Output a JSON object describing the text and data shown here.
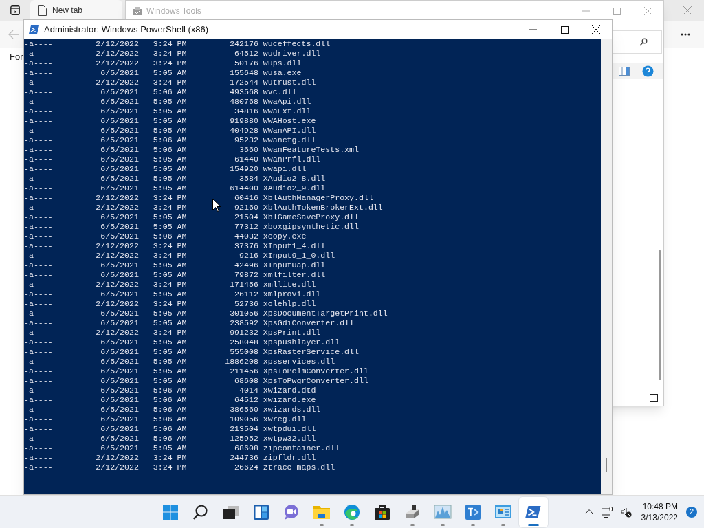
{
  "browser": {
    "tabs": [
      {
        "label": "New tab"
      }
    ],
    "page_text": "For"
  },
  "explorer": {
    "title": "Windows Tools"
  },
  "powershell": {
    "title": "Administrator: Windows PowerShell (x86)",
    "lines": [
      {
        "mode": "-a----",
        "date": "2/12/2022",
        "time": "3:24 PM",
        "size": "242176",
        "name": "wuceffects.dll"
      },
      {
        "mode": "-a----",
        "date": "2/12/2022",
        "time": "3:24 PM",
        "size": "64512",
        "name": "wudriver.dll"
      },
      {
        "mode": "-a----",
        "date": "2/12/2022",
        "time": "3:24 PM",
        "size": "50176",
        "name": "wups.dll"
      },
      {
        "mode": "-a----",
        "date": "6/5/2021",
        "time": "5:05 AM",
        "size": "155648",
        "name": "wusa.exe"
      },
      {
        "mode": "-a----",
        "date": "2/12/2022",
        "time": "3:24 PM",
        "size": "172544",
        "name": "wutrust.dll"
      },
      {
        "mode": "-a----",
        "date": "6/5/2021",
        "time": "5:06 AM",
        "size": "493568",
        "name": "wvc.dll"
      },
      {
        "mode": "-a----",
        "date": "6/5/2021",
        "time": "5:05 AM",
        "size": "480768",
        "name": "WwaApi.dll"
      },
      {
        "mode": "-a----",
        "date": "6/5/2021",
        "time": "5:05 AM",
        "size": "34816",
        "name": "WwaExt.dll"
      },
      {
        "mode": "-a----",
        "date": "6/5/2021",
        "time": "5:05 AM",
        "size": "919880",
        "name": "WWAHost.exe"
      },
      {
        "mode": "-a----",
        "date": "6/5/2021",
        "time": "5:05 AM",
        "size": "404928",
        "name": "WWanAPI.dll"
      },
      {
        "mode": "-a----",
        "date": "6/5/2021",
        "time": "5:06 AM",
        "size": "95232",
        "name": "wwancfg.dll"
      },
      {
        "mode": "-a----",
        "date": "6/5/2021",
        "time": "5:06 AM",
        "size": "3660",
        "name": "WwanFeatureTests.xml"
      },
      {
        "mode": "-a----",
        "date": "6/5/2021",
        "time": "5:05 AM",
        "size": "61440",
        "name": "WwanPrfl.dll"
      },
      {
        "mode": "-a----",
        "date": "6/5/2021",
        "time": "5:05 AM",
        "size": "154920",
        "name": "wwapi.dll"
      },
      {
        "mode": "-a----",
        "date": "6/5/2021",
        "time": "5:05 AM",
        "size": "3584",
        "name": "XAudio2_8.dll"
      },
      {
        "mode": "-a----",
        "date": "6/5/2021",
        "time": "5:05 AM",
        "size": "614400",
        "name": "XAudio2_9.dll"
      },
      {
        "mode": "-a----",
        "date": "2/12/2022",
        "time": "3:24 PM",
        "size": "60416",
        "name": "XblAuthManagerProxy.dll"
      },
      {
        "mode": "-a----",
        "date": "2/12/2022",
        "time": "3:24 PM",
        "size": "92160",
        "name": "XblAuthTokenBrokerExt.dll"
      },
      {
        "mode": "-a----",
        "date": "6/5/2021",
        "time": "5:05 AM",
        "size": "21504",
        "name": "XblGameSaveProxy.dll"
      },
      {
        "mode": "-a----",
        "date": "6/5/2021",
        "time": "5:05 AM",
        "size": "77312",
        "name": "xboxgipsynthetic.dll"
      },
      {
        "mode": "-a----",
        "date": "6/5/2021",
        "time": "5:06 AM",
        "size": "44032",
        "name": "xcopy.exe"
      },
      {
        "mode": "-a----",
        "date": "2/12/2022",
        "time": "3:24 PM",
        "size": "37376",
        "name": "XInput1_4.dll"
      },
      {
        "mode": "-a----",
        "date": "2/12/2022",
        "time": "3:24 PM",
        "size": "9216",
        "name": "XInput9_1_0.dll"
      },
      {
        "mode": "-a----",
        "date": "6/5/2021",
        "time": "5:05 AM",
        "size": "42496",
        "name": "XInputUap.dll"
      },
      {
        "mode": "-a----",
        "date": "6/5/2021",
        "time": "5:05 AM",
        "size": "79872",
        "name": "xmlfilter.dll"
      },
      {
        "mode": "-a----",
        "date": "2/12/2022",
        "time": "3:24 PM",
        "size": "171456",
        "name": "xmllite.dll"
      },
      {
        "mode": "-a----",
        "date": "6/5/2021",
        "time": "5:05 AM",
        "size": "26112",
        "name": "xmlprovi.dll"
      },
      {
        "mode": "-a----",
        "date": "2/12/2022",
        "time": "3:24 PM",
        "size": "52736",
        "name": "xolehlp.dll"
      },
      {
        "mode": "-a----",
        "date": "6/5/2021",
        "time": "5:05 AM",
        "size": "301056",
        "name": "XpsDocumentTargetPrint.dll"
      },
      {
        "mode": "-a----",
        "date": "6/5/2021",
        "time": "5:05 AM",
        "size": "238592",
        "name": "XpsGdiConverter.dll"
      },
      {
        "mode": "-a----",
        "date": "2/12/2022",
        "time": "3:24 PM",
        "size": "991232",
        "name": "XpsPrint.dll"
      },
      {
        "mode": "-a----",
        "date": "6/5/2021",
        "time": "5:05 AM",
        "size": "258048",
        "name": "xpspushlayer.dll"
      },
      {
        "mode": "-a----",
        "date": "6/5/2021",
        "time": "5:05 AM",
        "size": "555008",
        "name": "XpsRasterService.dll"
      },
      {
        "mode": "-a----",
        "date": "6/5/2021",
        "time": "5:05 AM",
        "size": "1886208",
        "name": "xpsservices.dll"
      },
      {
        "mode": "-a----",
        "date": "6/5/2021",
        "time": "5:05 AM",
        "size": "211456",
        "name": "XpsToPclmConverter.dll"
      },
      {
        "mode": "-a----",
        "date": "6/5/2021",
        "time": "5:05 AM",
        "size": "68608",
        "name": "XpsToPwgrConverter.dll"
      },
      {
        "mode": "-a----",
        "date": "6/5/2021",
        "time": "5:06 AM",
        "size": "4014",
        "name": "xwizard.dtd"
      },
      {
        "mode": "-a----",
        "date": "6/5/2021",
        "time": "5:06 AM",
        "size": "64512",
        "name": "xwizard.exe"
      },
      {
        "mode": "-a----",
        "date": "6/5/2021",
        "time": "5:06 AM",
        "size": "386560",
        "name": "xwizards.dll"
      },
      {
        "mode": "-a----",
        "date": "6/5/2021",
        "time": "5:06 AM",
        "size": "109056",
        "name": "xwreg.dll"
      },
      {
        "mode": "-a----",
        "date": "6/5/2021",
        "time": "5:06 AM",
        "size": "213504",
        "name": "xwtpdui.dll"
      },
      {
        "mode": "-a----",
        "date": "6/5/2021",
        "time": "5:06 AM",
        "size": "125952",
        "name": "xwtpw32.dll"
      },
      {
        "mode": "-a----",
        "date": "6/5/2021",
        "time": "5:05 AM",
        "size": "68608",
        "name": "zipcontainer.dll"
      },
      {
        "mode": "-a----",
        "date": "2/12/2022",
        "time": "3:24 PM",
        "size": "244736",
        "name": "zipfldr.dll"
      },
      {
        "mode": "-a----",
        "date": "2/12/2022",
        "time": "3:24 PM",
        "size": "26624",
        "name": "ztrace_maps.dll"
      }
    ]
  },
  "taskbar": {
    "apps": [
      {
        "kind": "start",
        "running": false,
        "selected": false
      },
      {
        "kind": "search",
        "running": false,
        "selected": false
      },
      {
        "kind": "taskview",
        "running": false,
        "selected": false
      },
      {
        "kind": "widgets",
        "running": false,
        "selected": false
      },
      {
        "kind": "chat",
        "running": false,
        "selected": false
      },
      {
        "kind": "folder",
        "running": true,
        "selected": false
      },
      {
        "kind": "browser",
        "running": true,
        "selected": false
      },
      {
        "kind": "store",
        "running": false,
        "selected": false
      },
      {
        "kind": "cleanup",
        "running": true,
        "selected": false
      },
      {
        "kind": "monitor",
        "running": true,
        "selected": false
      },
      {
        "kind": "teams",
        "running": true,
        "selected": false
      },
      {
        "kind": "controlpanel",
        "running": true,
        "selected": false
      },
      {
        "kind": "powershell",
        "running": true,
        "selected": true
      }
    ],
    "clock": {
      "time": "10:48 PM",
      "date": "3/13/2022"
    },
    "notifications": "2"
  }
}
